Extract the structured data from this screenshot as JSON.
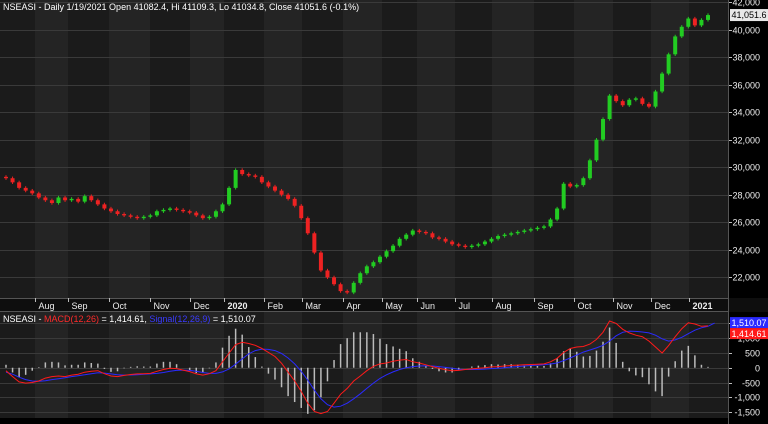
{
  "header": {
    "symbol": "NSEASI",
    "description": "Daily 1/19/2021 Open 41082.4, Hi 41109.3, Lo 41034.8, Close 41051.6 (-0.1%)"
  },
  "macd_header": {
    "symbol": "NSEASI",
    "macd_label": "MACD(12,26)",
    "macd_value": "= 1,414.61,",
    "signal_label": "Signal(12,26,9)",
    "signal_value": "= 1,510.07"
  },
  "chart_data": [
    {
      "type": "candlestick",
      "name": "NSEASI",
      "x_labels": [
        "Aug",
        "Sep",
        "Oct",
        "Nov",
        "Dec",
        "2020",
        "Feb",
        "Mar",
        "Apr",
        "May",
        "Jun",
        "Jul",
        "Aug",
        "Sep",
        "Oct",
        "Nov",
        "Dec",
        "2021"
      ],
      "ylim": [
        20500,
        42000
      ],
      "y_ticks": [
        22000,
        24000,
        26000,
        28000,
        30000,
        32000,
        34000,
        36000,
        38000,
        40000,
        42000
      ],
      "y_tick_labels": [
        "22,000",
        "24,000",
        "26,000",
        "28,000",
        "30,000",
        "32,000",
        "34,000",
        "36,000",
        "38,000",
        "40,000",
        "42,000"
      ],
      "last_price_label": "41,051.6",
      "last_price": 41051.6,
      "grid": true,
      "up_color": "#22cc22",
      "down_color": "#ee2222",
      "closes": [
        29200,
        28900,
        28500,
        28300,
        28100,
        27800,
        27600,
        27400,
        27800,
        27600,
        27700,
        27500,
        27900,
        27600,
        27300,
        27000,
        26800,
        26600,
        26500,
        26400,
        26300,
        26400,
        26500,
        26800,
        26900,
        27000,
        26900,
        26800,
        26700,
        26500,
        26300,
        26400,
        26800,
        27300,
        28500,
        29800,
        29500,
        29400,
        29300,
        28900,
        28600,
        28300,
        28000,
        27700,
        27200,
        26300,
        25200,
        23800,
        22500,
        22000,
        21500,
        21000,
        20900,
        21600,
        22300,
        22800,
        23100,
        23500,
        23900,
        24300,
        24800,
        25100,
        25400,
        25300,
        25200,
        24900,
        24800,
        24600,
        24400,
        24300,
        24200,
        24300,
        24400,
        24600,
        24800,
        25000,
        25100,
        25200,
        25300,
        25400,
        25500,
        25600,
        25700,
        26200,
        27000,
        28800,
        28600,
        28700,
        29200,
        30500,
        32000,
        33500,
        35200,
        34800,
        34500,
        34900,
        35000,
        34600,
        34400,
        35500,
        36800,
        38200,
        39500,
        40200,
        40800,
        40300,
        40700,
        41050
      ]
    },
    {
      "type": "line",
      "name": "MACD",
      "ylim": [
        -1700,
        1750
      ],
      "y_ticks": [
        -1500,
        -1000,
        -500,
        0,
        500,
        1000,
        1500
      ],
      "y_tick_labels": [
        "-1,500",
        "-1,000",
        "-500",
        "0",
        "500",
        "1,000",
        "1,500"
      ],
      "macd_badge": "1,414.61",
      "signal_badge": "1,510.07",
      "macd_color": "#ff1a1a",
      "signal_color": "#2a2aff",
      "histogram_color": "#bbbbbb",
      "series": [
        {
          "name": "MACD(12,26)",
          "values": [
            -100,
            -300,
            -480,
            -520,
            -500,
            -450,
            -350,
            -300,
            -280,
            -300,
            -250,
            -220,
            -150,
            -120,
            -100,
            -200,
            -280,
            -300,
            -260,
            -230,
            -210,
            -200,
            -190,
            -120,
            -60,
            -20,
            -30,
            -80,
            -130,
            -210,
            -250,
            -200,
            -100,
            200,
            500,
            780,
            860,
            820,
            760,
            650,
            520,
            380,
            150,
            -150,
            -450,
            -800,
            -1200,
            -1480,
            -1550,
            -1480,
            -1200,
            -900,
            -700,
            -450,
            -280,
            -100,
            50,
            130,
            160,
            220,
            260,
            280,
            200,
            160,
            100,
            40,
            -20,
            -70,
            -100,
            -90,
            -60,
            -40,
            -20,
            0,
            30,
            40,
            60,
            80,
            90,
            100,
            110,
            120,
            130,
            200,
            320,
            520,
            650,
            700,
            720,
            800,
            960,
            1200,
            1580,
            1500,
            1300,
            1180,
            1100,
            1050,
            900,
            700,
            500,
            750,
            1050,
            1320,
            1520,
            1480,
            1400,
            1415
          ]
        },
        {
          "name": "Signal(12,26,9)",
          "values": [
            -150,
            -220,
            -320,
            -400,
            -450,
            -460,
            -440,
            -400,
            -370,
            -340,
            -300,
            -270,
            -240,
            -200,
            -170,
            -180,
            -210,
            -240,
            -250,
            -245,
            -235,
            -220,
            -210,
            -190,
            -160,
            -120,
            -90,
            -80,
            -90,
            -120,
            -160,
            -190,
            -190,
            -140,
            -40,
            120,
            300,
            470,
            580,
            630,
            620,
            580,
            480,
            330,
            130,
            -120,
            -420,
            -760,
            -1050,
            -1250,
            -1330,
            -1300,
            -1200,
            -1050,
            -880,
            -700,
            -520,
            -360,
            -240,
            -140,
            -60,
            0,
            40,
            60,
            70,
            60,
            40,
            10,
            -20,
            -50,
            -60,
            -60,
            -55,
            -45,
            -30,
            -15,
            0,
            20,
            40,
            60,
            75,
            90,
            100,
            125,
            160,
            240,
            330,
            430,
            530,
            600,
            670,
            760,
            900,
            1080,
            1200,
            1240,
            1230,
            1210,
            1180,
            1100,
            980,
            900,
            940,
            1030,
            1150,
            1270,
            1350,
            1400,
            1510
          ]
        }
      ]
    }
  ]
}
